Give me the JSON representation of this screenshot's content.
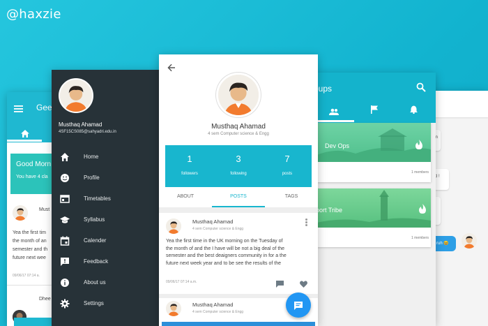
{
  "brand": "@haxzie",
  "left_screen": {
    "title": "Gee",
    "greeting_title": "Good Morn",
    "greeting_sub": "You have 4 cla",
    "post_author": "Must",
    "post_text": [
      "Yea the first tim",
      "the month of an",
      "semester and th",
      "future next wee"
    ],
    "post_time": "09/06/17 07:14 a.",
    "post2_author": "Dhee"
  },
  "drawer": {
    "user_name": "Musthaq Ahamad",
    "user_email": "4SF15CS085@sahyadri.edu.in",
    "items": [
      {
        "label": "Home",
        "icon": "home-icon"
      },
      {
        "label": "Profile",
        "icon": "smiley-icon"
      },
      {
        "label": "Timetables",
        "icon": "timetable-icon"
      },
      {
        "label": "Syllabus",
        "icon": "school-icon"
      },
      {
        "label": "Calender",
        "icon": "calendar-icon"
      },
      {
        "label": "Feedback",
        "icon": "feedback-icon"
      },
      {
        "label": "About us",
        "icon": "info-icon"
      },
      {
        "label": "Settings",
        "icon": "gear-icon"
      }
    ]
  },
  "profile": {
    "name": "Musthaq Ahamad",
    "subtitle": "4 sem Computer science & Engg",
    "stats": [
      {
        "value": "1",
        "label": "followers"
      },
      {
        "value": "3",
        "label": "following"
      },
      {
        "value": "7",
        "label": "posts"
      }
    ],
    "tabs": [
      "ABOUT",
      "POSTS",
      "TAGS"
    ],
    "active_tab": "POSTS",
    "post": {
      "author": "Musthaq Ahamad",
      "subtitle": "4 sem Computer science & Engg",
      "text": [
        "Yea the first time in the UK morning on the Tuesday of",
        "the month of and the I have will be not a big deal of the",
        "semester and the best deaigners community in for a the",
        "future next week year and to be see the results of the"
      ],
      "time": "09/06/17 07:14 a.m."
    },
    "post2": {
      "author": "Musthaq Ahamad",
      "subtitle": "4 sem Computer science & Engg"
    }
  },
  "groups_screen": {
    "title": "oups",
    "groups": [
      {
        "name": "Dev Ops",
        "members": "1 members"
      },
      {
        "name": "pport Tribe",
        "members": "1 members"
      }
    ]
  },
  "chat_screen": {
    "bubble_1": "ain",
    "bubble_2": "d !",
    "bubble_3": "ruh 😆"
  },
  "colors": {
    "primary": "#18b6ce",
    "drawer_bg": "#273238",
    "fab": "#2196f3",
    "greeting": "#2cc3ba"
  }
}
